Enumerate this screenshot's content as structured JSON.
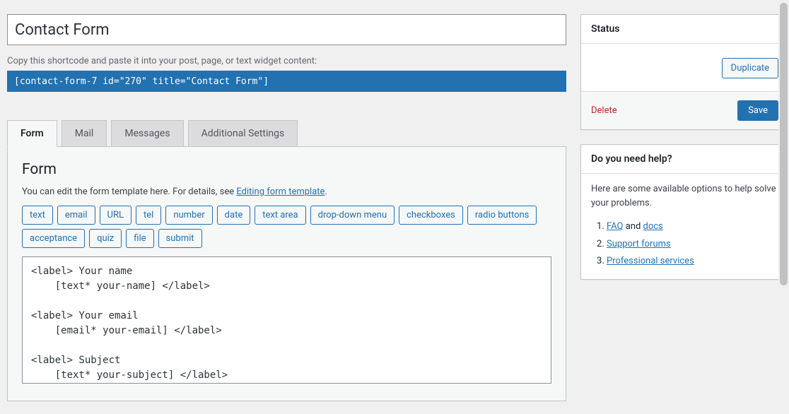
{
  "title_value": "Contact Form",
  "shortcode_hint": "Copy this shortcode and paste it into your post, page, or text widget content:",
  "shortcode_value": "[contact-form-7 id=\"270\" title=\"Contact Form\"]",
  "tabs": {
    "form": "Form",
    "mail": "Mail",
    "messages": "Messages",
    "additional": "Additional Settings"
  },
  "form_panel": {
    "heading": "Form",
    "desc_prefix": "You can edit the form template here. For details, see ",
    "desc_link": "Editing form template",
    "desc_suffix": ".",
    "tag_buttons": [
      "text",
      "email",
      "URL",
      "tel",
      "number",
      "date",
      "text area",
      "drop-down menu",
      "checkboxes",
      "radio buttons",
      "acceptance",
      "quiz",
      "file",
      "submit"
    ],
    "code": "<label> Your name\n    [text* your-name] </label>\n\n<label> Your email\n    [email* your-email] </label>\n\n<label> Subject\n    [text* your-subject] </label>"
  },
  "status": {
    "heading": "Status",
    "duplicate": "Duplicate",
    "delete": "Delete",
    "save": "Save"
  },
  "help": {
    "heading": "Do you need help?",
    "intro": "Here are some available options to help solve your problems.",
    "item1_link1": "FAQ",
    "item1_mid": " and ",
    "item1_link2": "docs",
    "item2_link": "Support forums",
    "item3_link": "Professional services"
  }
}
